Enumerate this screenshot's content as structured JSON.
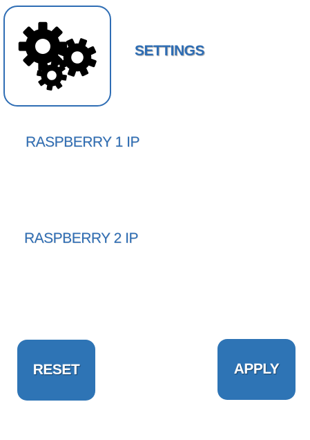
{
  "header": {
    "icon": "gears-icon",
    "title": "SETTINGS"
  },
  "fields": [
    {
      "label": "RASPBERRY 1 IP",
      "value": ""
    },
    {
      "label": "RASPBERRY 2 IP",
      "value": ""
    }
  ],
  "buttons": {
    "reset_label": "RESET",
    "apply_label": "APPLY"
  },
  "colors": {
    "accent": "#2e74b5",
    "icon": "#000000",
    "background": "#ffffff"
  }
}
